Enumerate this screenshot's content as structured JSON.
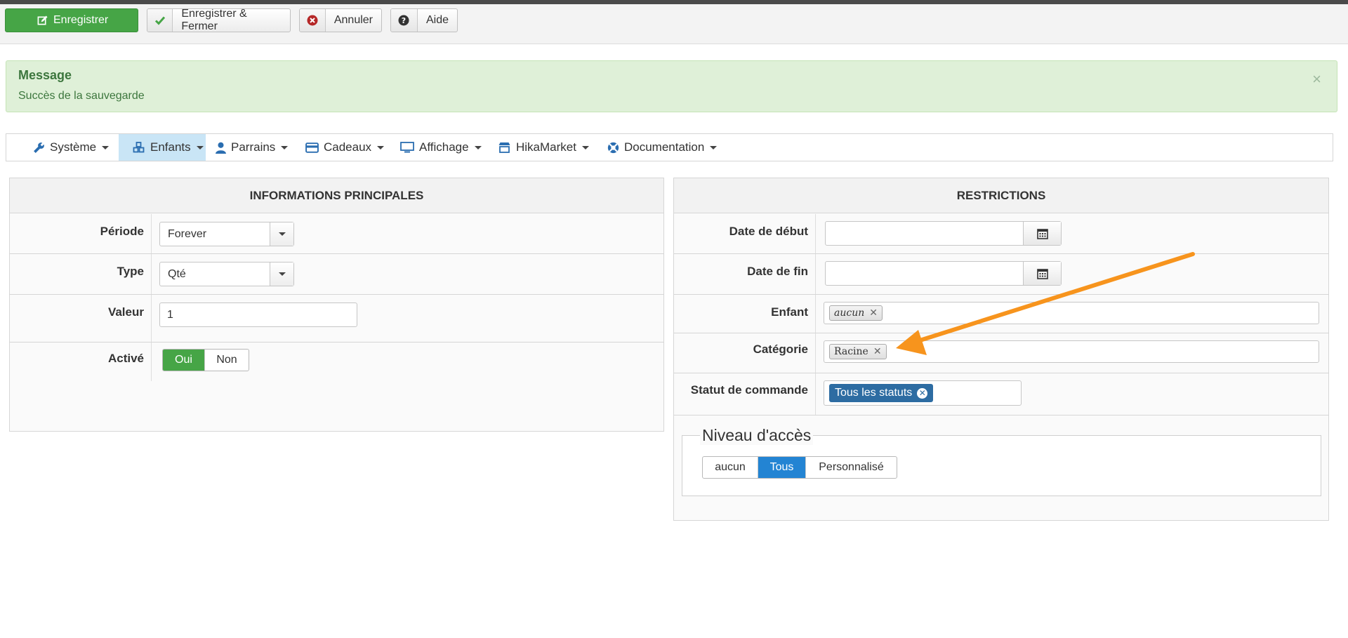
{
  "toolbar": {
    "save_label": "Enregistrer",
    "save_close_label": "Enregistrer & Fermer",
    "cancel_label": "Annuler",
    "help_label": "Aide"
  },
  "message": {
    "title": "Message",
    "text": "Succès de la sauvegarde",
    "close_symbol": "×"
  },
  "nav": {
    "items": [
      {
        "label": "Système",
        "icon": "wrench-icon"
      },
      {
        "label": "Enfants",
        "icon": "cubes-icon",
        "active": true
      },
      {
        "label": "Parrains",
        "icon": "user-icon"
      },
      {
        "label": "Cadeaux",
        "icon": "credit-card-icon"
      },
      {
        "label": "Affichage",
        "icon": "monitor-icon"
      },
      {
        "label": "HikaMarket",
        "icon": "store-icon"
      },
      {
        "label": "Documentation",
        "icon": "lifebuoy-icon"
      }
    ]
  },
  "main_panel": {
    "title": "INFORMATIONS PRINCIPALES",
    "periode_label": "Période",
    "periode_value": "Forever",
    "type_label": "Type",
    "type_value": "Qté",
    "valeur_label": "Valeur",
    "valeur_value": "1",
    "active_label": "Activé",
    "active_yes": "Oui",
    "active_no": "Non",
    "active_selected": "Oui"
  },
  "restrictions": {
    "title": "RESTRICTIONS",
    "start_label": "Date de début",
    "end_label": "Date de fin",
    "child_label": "Enfant",
    "child_tag": "aucun",
    "category_label": "Catégorie",
    "category_tag": "Racine",
    "order_status_label": "Statut de commande",
    "order_status_tag": "Tous les statuts",
    "access_legend": "Niveau d'accès",
    "access_options": [
      "aucun",
      "Tous",
      "Personnalisé"
    ],
    "access_selected": "Tous"
  },
  "colors": {
    "success_green": "#46a546",
    "selected_blue": "#2384d3",
    "tag_blue": "#2d6ca2",
    "annotation_orange": "#f7941d",
    "alert_bg": "#dff0d8"
  }
}
